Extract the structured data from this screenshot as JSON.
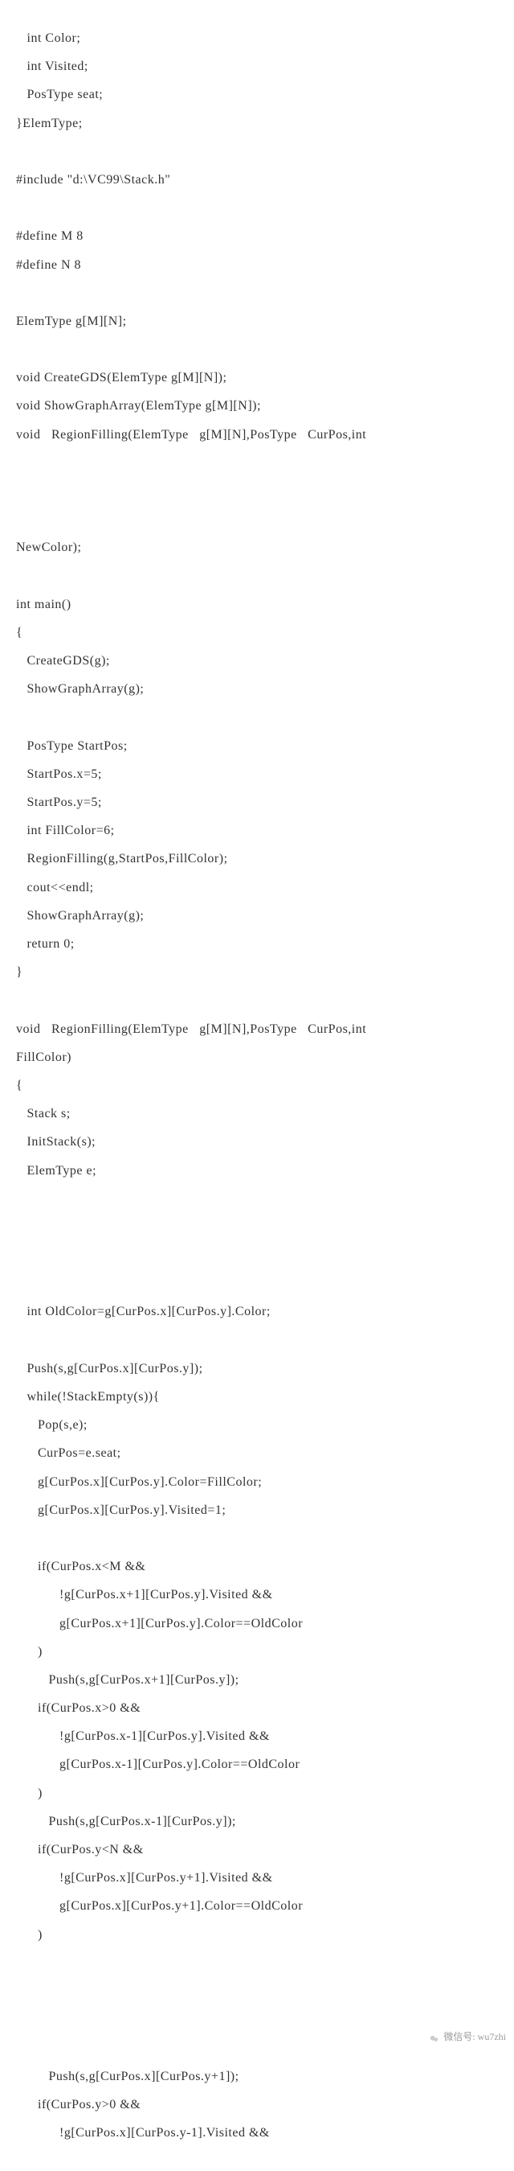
{
  "code_lines": [
    "   int Color;",
    "   int Visited;",
    "   PosType seat;",
    "}ElemType;",
    "",
    "#include \"d:\\VC99\\Stack.h\"",
    "",
    "#define M 8",
    "#define N 8",
    "",
    "ElemType g[M][N];",
    "",
    "void CreateGDS(ElemType g[M][N]);",
    "void ShowGraphArray(ElemType g[M][N]);",
    "void   RegionFilling(ElemType   g[M][N],PosType   CurPos,int",
    "",
    "",
    "",
    "NewColor);",
    "",
    "int main()",
    "{",
    "   CreateGDS(g);",
    "   ShowGraphArray(g);",
    "",
    "   PosType StartPos;",
    "   StartPos.x=5;",
    "   StartPos.y=5;",
    "   int FillColor=6;",
    "   RegionFilling(g,StartPos,FillColor);",
    "   cout<<endl;",
    "   ShowGraphArray(g);",
    "   return 0;",
    "}",
    "",
    "void   RegionFilling(ElemType   g[M][N],PosType   CurPos,int",
    "FillColor)",
    "{  ",
    "   Stack s;",
    "   InitStack(s);",
    "   ElemType e;",
    "",
    "",
    "",
    "",
    "   int OldColor=g[CurPos.x][CurPos.y].Color;",
    "",
    "   Push(s,g[CurPos.x][CurPos.y]);",
    "   while(!StackEmpty(s)){",
    "      Pop(s,e);",
    "      CurPos=e.seat;",
    "      g[CurPos.x][CurPos.y].Color=FillColor;",
    "      g[CurPos.x][CurPos.y].Visited=1;",
    "",
    "      if(CurPos.x<M &&",
    "            !g[CurPos.x+1][CurPos.y].Visited &&",
    "            g[CurPos.x+1][CurPos.y].Color==OldColor",
    "      )",
    "         Push(s,g[CurPos.x+1][CurPos.y]);",
    "      if(CurPos.x>0 &&",
    "            !g[CurPos.x-1][CurPos.y].Visited &&",
    "            g[CurPos.x-1][CurPos.y].Color==OldColor",
    "      )",
    "         Push(s,g[CurPos.x-1][CurPos.y]);",
    "      if(CurPos.y<N &&",
    "            !g[CurPos.x][CurPos.y+1].Visited &&",
    "            g[CurPos.x][CurPos.y+1].Color==OldColor",
    "      )",
    "",
    "",
    "",
    "",
    "         Push(s,g[CurPos.x][CurPos.y+1]);",
    "      if(CurPos.y>0 &&",
    "            !g[CurPos.x][CurPos.y-1].Visited &&"
  ],
  "watermark": {
    "label": "微信号: wu7zhi"
  }
}
